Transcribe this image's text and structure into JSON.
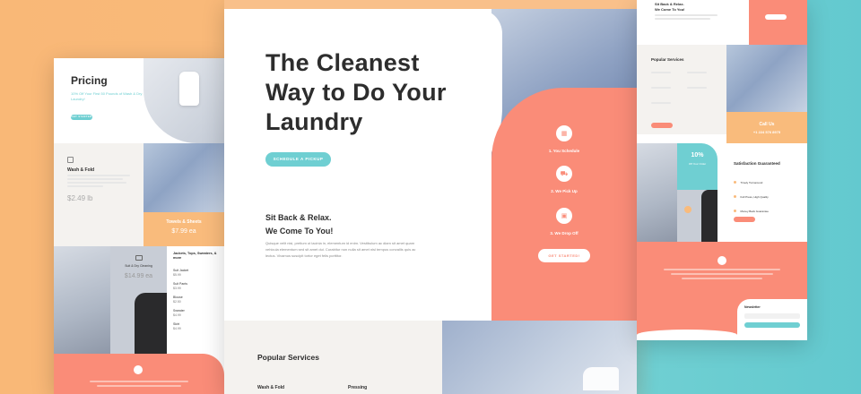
{
  "left_page": {
    "pricing": {
      "title": "Pricing",
      "subtitle": "10% Off Your First 50 Pounds of Wash & Dry Laundry!",
      "button_label": "GET STARTED"
    },
    "wash_fold": {
      "title": "Wash & Fold",
      "price": "$2.49 lb"
    },
    "towels_sheets": {
      "title": "Towels & Sheets",
      "price": "$7.99 ea"
    },
    "suit_dry_cleaning": {
      "title": "Suit & Dry Cleaning",
      "price": "$14.99 ea"
    },
    "jackets": {
      "title": "Jackets, Tops, Sweaters, & more",
      "items": [
        {
          "label": "Suit Jacket",
          "price": "$5.99"
        },
        {
          "label": "Suit Pants",
          "price": "$3.99"
        },
        {
          "label": "Blouse",
          "price": "$2.50"
        },
        {
          "label": "Sweater",
          "price": "$4.99"
        },
        {
          "label": "Skirt",
          "price": "$4.99"
        }
      ]
    }
  },
  "main_page": {
    "hero": {
      "title": "The Cleanest Way to Do Your Laundry",
      "cta_label": "SCHEDULE A PICKUP"
    },
    "relax": {
      "line1": "Sit Back & Relax.",
      "line2": "We Come To You!",
      "paragraph": "Quisque velit nisi, pretium ut lacinia in, elementum id enim. Vestibulum ac diam sit amet quam vehicula elementum sed sit amet dui. Curabitur non nulla sit amet nisl tempus convallis quis ac lectus. Vivamus suscipit tortor eget felis porttitor."
    },
    "steps": [
      {
        "label": "1. You Schedule",
        "icon": "calendar-icon"
      },
      {
        "label": "2. We Pick Up",
        "icon": "cart-icon"
      },
      {
        "label": "3. We Drop Off",
        "icon": "box-icon"
      }
    ],
    "steps_button": "GET STARTED!",
    "popular": {
      "title": "Popular Services",
      "services": [
        "Wash & Fold",
        "Pressing"
      ]
    }
  },
  "right_page": {
    "top": {
      "line1": "Sit Back & Relax.",
      "line2": "We Come To You!"
    },
    "popular_title": "Popular Services",
    "call": {
      "label": "Call Us",
      "phone": "+1 224 576 8975"
    },
    "discount": {
      "value": "10%",
      "label": "Off Your Order"
    },
    "satisfaction": {
      "title": "Satisfaction Guaranteed",
      "items": [
        "Timely Turnaround",
        "Full Press, High Quality",
        "Money Back Guarantee"
      ]
    },
    "footer": {
      "newsletter_label": "Newsletter"
    }
  },
  "colors": {
    "coral": "#fa8c78",
    "teal": "#6fcfd2",
    "orange_bg": "#f9b877",
    "dark_text": "#2d2d2d"
  }
}
